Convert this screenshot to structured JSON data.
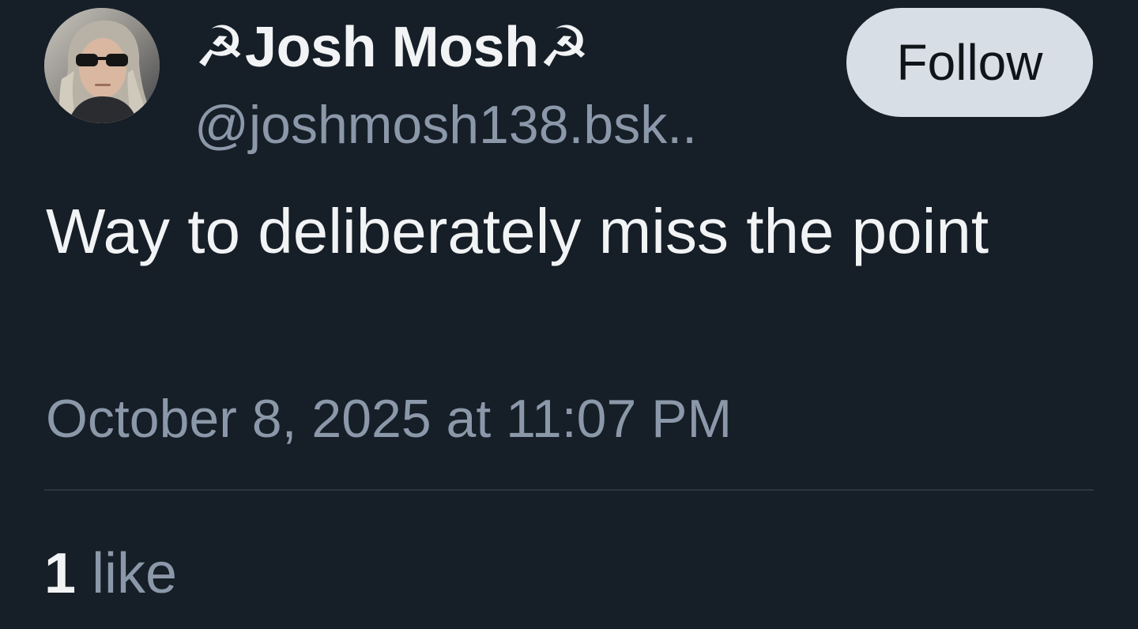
{
  "author": {
    "display_name": "☭Josh Mosh☭",
    "handle": "@joshmosh138.bsk.."
  },
  "actions": {
    "follow_label": "Follow"
  },
  "post": {
    "text": "Way to deliberately miss the point",
    "timestamp": "October 8, 2025 at 11:07 PM"
  },
  "stats": {
    "like_count": "1",
    "like_label": "like"
  },
  "colors": {
    "background": "#161e27",
    "primary_text": "#f1f3f5",
    "secondary_text": "#8b98a9",
    "follow_button_bg": "#d8dee6",
    "divider": "#2a3642"
  },
  "icons": {
    "avatar": "user-avatar-photo"
  }
}
